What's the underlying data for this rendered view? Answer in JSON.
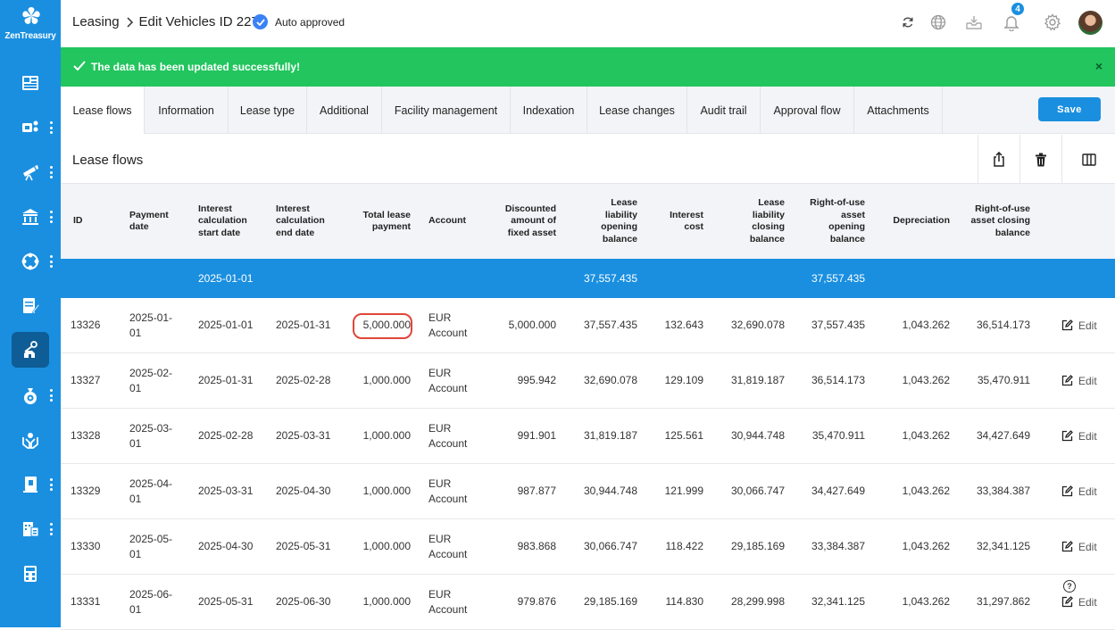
{
  "app": {
    "name": "ZenTreasury"
  },
  "header": {
    "breadcrumb_parent": "Leasing",
    "breadcrumb_current": "Edit Vehicles ID 227",
    "status": "Auto approved",
    "notification_count": "4"
  },
  "banner": {
    "message": "The data has been updated successfully!",
    "close": "×"
  },
  "tabs": [
    {
      "label": "Lease flows",
      "active": true
    },
    {
      "label": "Information"
    },
    {
      "label": "Lease type"
    },
    {
      "label": "Additional"
    },
    {
      "label": "Facility management"
    },
    {
      "label": "Indexation"
    },
    {
      "label": "Lease changes"
    },
    {
      "label": "Audit trail"
    },
    {
      "label": "Approval flow"
    },
    {
      "label": "Attachments"
    }
  ],
  "save_label": "Save",
  "section": {
    "title": "Lease flows"
  },
  "table": {
    "columns": [
      "ID",
      "Payment\ndate",
      "Interest\ncalculation\nstart date",
      "Interest\ncalculation\nend date",
      "Total lease\npayment",
      "Account",
      "Discounted\namount of\nfixed asset",
      "Lease\nliability\nopening\nbalance",
      "Interest\ncost",
      "Lease\nliability\nclosing\nbalance",
      "Right-of-use\nasset\nopening\nbalance",
      "Depreciation",
      "Right-of-use\nasset closing\nbalance"
    ],
    "summary": {
      "start_date": "2025-01-01",
      "liability_opening": "37,557.435",
      "rou_opening": "37,557.435"
    },
    "rows": [
      {
        "id": "13326",
        "payment_date": "2025-01-\n01",
        "start": "2025-01-01",
        "end": "2025-01-31",
        "total": "5,000.000",
        "account": "EUR\nAccount",
        "discounted": "5,000.000",
        "liab_open": "37,557.435",
        "interest": "132.643",
        "liab_close": "32,690.078",
        "rou_open": "37,557.435",
        "depreciation": "1,043.262",
        "rou_close": "36,514.173",
        "edit": "Edit"
      },
      {
        "id": "13327",
        "payment_date": "2025-02-\n01",
        "start": "2025-01-31",
        "end": "2025-02-28",
        "total": "1,000.000",
        "account": "EUR\nAccount",
        "discounted": "995.942",
        "liab_open": "32,690.078",
        "interest": "129.109",
        "liab_close": "31,819.187",
        "rou_open": "36,514.173",
        "depreciation": "1,043.262",
        "rou_close": "35,470.911",
        "edit": "Edit"
      },
      {
        "id": "13328",
        "payment_date": "2025-03-\n01",
        "start": "2025-02-28",
        "end": "2025-03-31",
        "total": "1,000.000",
        "account": "EUR\nAccount",
        "discounted": "991.901",
        "liab_open": "31,819.187",
        "interest": "125.561",
        "liab_close": "30,944.748",
        "rou_open": "35,470.911",
        "depreciation": "1,043.262",
        "rou_close": "34,427.649",
        "edit": "Edit"
      },
      {
        "id": "13329",
        "payment_date": "2025-04-\n01",
        "start": "2025-03-31",
        "end": "2025-04-30",
        "total": "1,000.000",
        "account": "EUR\nAccount",
        "discounted": "987.877",
        "liab_open": "30,944.748",
        "interest": "121.999",
        "liab_close": "30,066.747",
        "rou_open": "34,427.649",
        "depreciation": "1,043.262",
        "rou_close": "33,384.387",
        "edit": "Edit"
      },
      {
        "id": "13330",
        "payment_date": "2025-05-\n01",
        "start": "2025-04-30",
        "end": "2025-05-31",
        "total": "1,000.000",
        "account": "EUR\nAccount",
        "discounted": "983.868",
        "liab_open": "30,066.747",
        "interest": "118.422",
        "liab_close": "29,185.169",
        "rou_open": "33,384.387",
        "depreciation": "1,043.262",
        "rou_close": "32,341.125",
        "edit": "Edit"
      },
      {
        "id": "13331",
        "payment_date": "2025-06-\n01",
        "start": "2025-05-31",
        "end": "2025-06-30",
        "total": "1,000.000",
        "account": "EUR\nAccount",
        "discounted": "979.876",
        "liab_open": "29,185.169",
        "interest": "114.830",
        "liab_close": "28,299.998",
        "rou_open": "32,341.125",
        "depreciation": "1,043.262",
        "rou_close": "31,297.862",
        "edit": "Edit"
      }
    ]
  },
  "help_label": "?",
  "colors": {
    "primary": "#1a8fe0",
    "success": "#22c55e",
    "highlight": "#e0463b"
  }
}
